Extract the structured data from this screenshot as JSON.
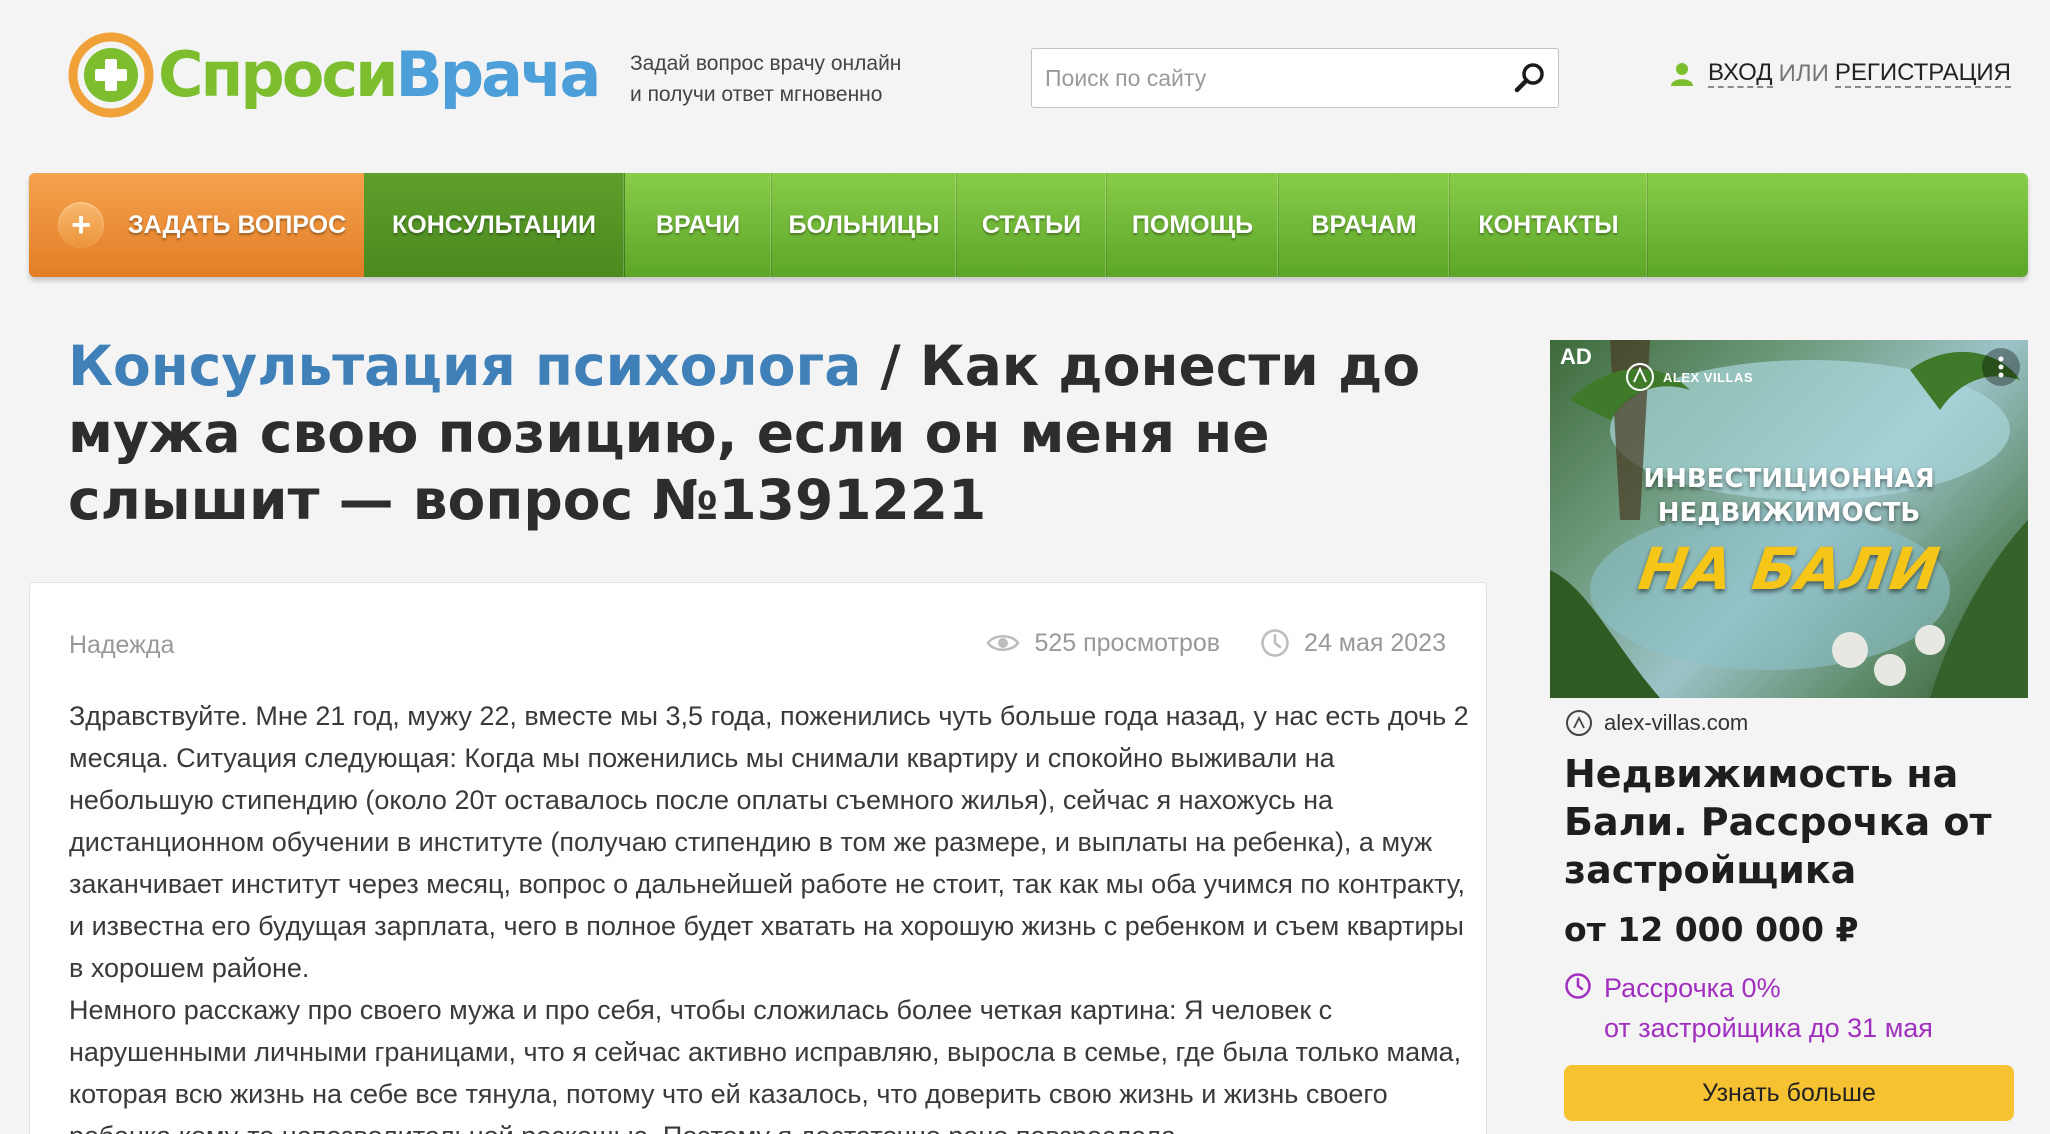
{
  "header": {
    "logo": {
      "part1": "Спроси",
      "part2": "Врача"
    },
    "tagline": {
      "line1": "Задай вопрос врачу онлайн",
      "line2": "и получи ответ мгновенно"
    },
    "search": {
      "placeholder": "Поиск по сайту",
      "value": ""
    },
    "auth": {
      "login": "Вход",
      "or": "или",
      "register": "Регистрация"
    }
  },
  "nav": {
    "ask": "Задать вопрос",
    "items": [
      "Консультации",
      "Врачи",
      "Больницы",
      "Статьи",
      "Помощь",
      "Врачам",
      "Контакты"
    ],
    "active_index": 0
  },
  "page": {
    "breadcrumb": "Консультация психолога",
    "separator": " / ",
    "title": "Как донести до мужа свою позицию, если он меня не слышит — вопрос №1391221"
  },
  "question": {
    "author": "Надежда",
    "views": "525 просмотров",
    "date": "24 мая 2023",
    "paragraph1": "Здравствуйте. Мне 21 год, мужу 22, вместе мы 3,5 года, поженились чуть больше года назад, у нас есть дочь 2 месяца. Ситуация следующая: Когда мы поженились мы снимали квартиру и спокойно выживали на небольшую стипендию (около 20т оставалось после оплаты съемного жилья), сейчас я нахожусь на дистанционном обучении в институте (получаю стипендию в том же размере, и выплаты на ребенка), а муж заканчивает институт через месяц, вопрос о дальнейшей работе не стоит, так как мы оба учимся по контракту, и известна его будущая зарплата, чего в полное будет хватать на хорошую жизнь с ребенком и съем квартиры в хорошем районе.",
    "paragraph2": "Немного расскажу про своего мужа и про себя, чтобы сложилась более четкая картина: Я человек с нарушенными личными границами, что я сейчас активно исправляю, выросла в семье, где была только мама, которая всю жизнь на себе все тянула, потому что ей казалось, что доверить свою жизнь и жизнь своего ребенка кому-то непозволительной роскошью. Поэтому я достаточно рано повзрослела"
  },
  "ad": {
    "label": "AD",
    "brand": "ALEX VILLAS",
    "image_line1": "ИНВЕСТИЦИОННАЯ",
    "image_line2": "НЕДВИЖИМОСТЬ",
    "image_line3": "НА БАЛИ",
    "domain": "alex-villas.com",
    "headline": "Недвижимость на Бали. Рассрочка от застройщика",
    "price": "от 12 000 000 ₽",
    "promo_line1": "Рассрочка 0%",
    "promo_line2": "от застройщика до 31 мая",
    "button": "Узнать больше"
  },
  "colors": {
    "brand_green": "#7cbe2e",
    "brand_blue": "#4c9fd9",
    "nav_green": "#6db334",
    "ask_orange": "#e8892e",
    "link_blue": "#3f80b8",
    "ad_button": "#f7c232",
    "promo_purple": "#a12fbf"
  },
  "icons": {
    "search": "search-icon",
    "user": "user-icon",
    "eye": "eye-icon",
    "clock": "clock-icon",
    "plus": "plus-icon"
  }
}
